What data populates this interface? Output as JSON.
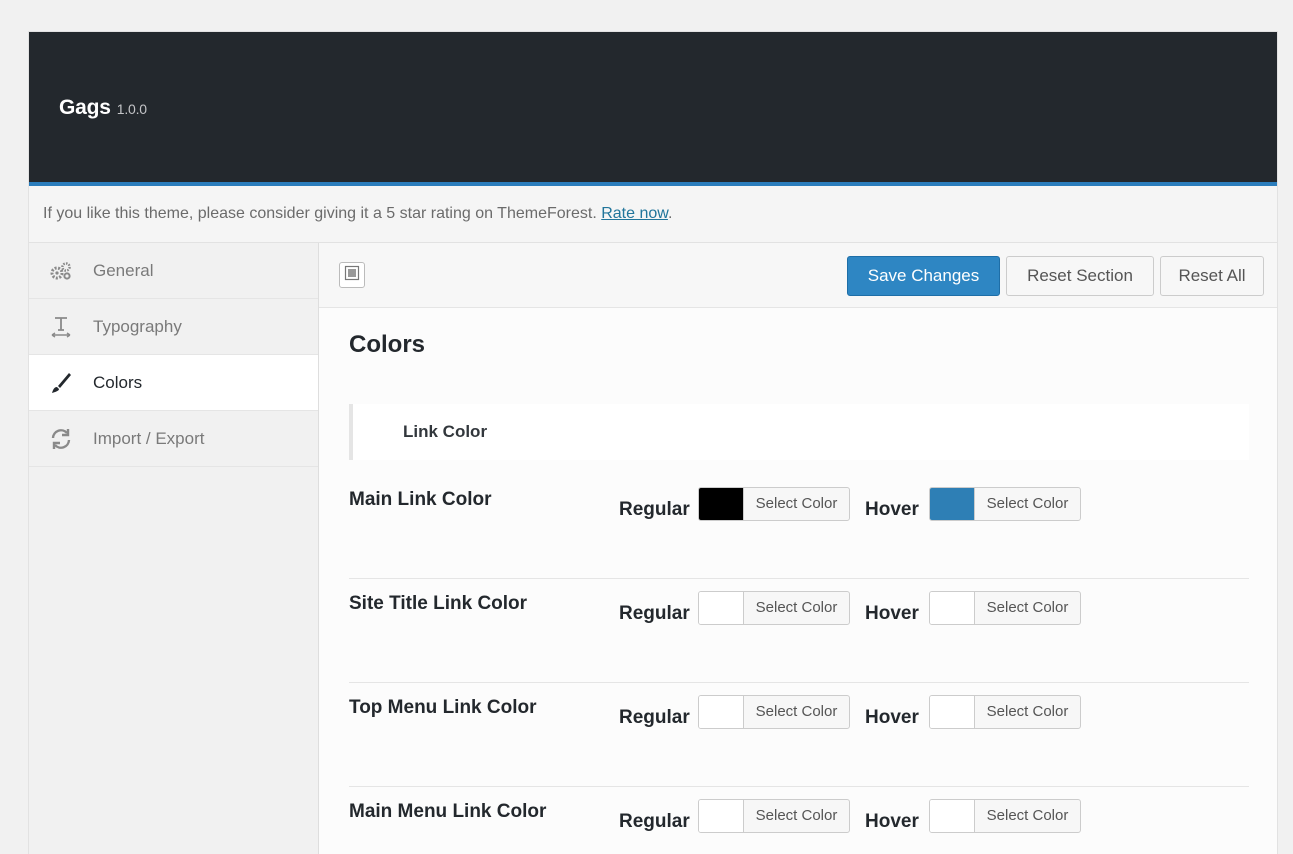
{
  "app": {
    "title": "Gags",
    "version": "1.0.0"
  },
  "notice": {
    "text": "If you like this theme, please consider giving it a 5 star rating on ThemeForest.",
    "link_label": "Rate now",
    "suffix": "."
  },
  "sidebar": {
    "items": [
      {
        "label": "General",
        "icon": "gears-icon"
      },
      {
        "label": "Typography",
        "icon": "typography-icon"
      },
      {
        "label": "Colors",
        "icon": "brush-icon",
        "active": true
      },
      {
        "label": "Import / Export",
        "icon": "refresh-icon"
      }
    ]
  },
  "toolbar": {
    "save_label": "Save Changes",
    "reset_section_label": "Reset Section",
    "reset_all_label": "Reset All"
  },
  "section": {
    "title": "Colors",
    "subsection": "Link Color"
  },
  "picker_labels": {
    "regular": "Regular",
    "hover": "Hover",
    "select": "Select Color"
  },
  "fields": [
    {
      "label": "Main Link Color",
      "regular_color": "#000000",
      "hover_color": "#2e7fb5"
    },
    {
      "label": "Site Title Link Color",
      "regular_color": "#ffffff",
      "hover_color": "#ffffff"
    },
    {
      "label": "Top Menu Link Color",
      "regular_color": "#ffffff",
      "hover_color": "#ffffff"
    },
    {
      "label": "Main Menu Link Color",
      "regular_color": "#ffffff",
      "hover_color": "#ffffff"
    }
  ],
  "colors": {
    "header_bg": "#23282d",
    "accent": "#2e86c3"
  }
}
